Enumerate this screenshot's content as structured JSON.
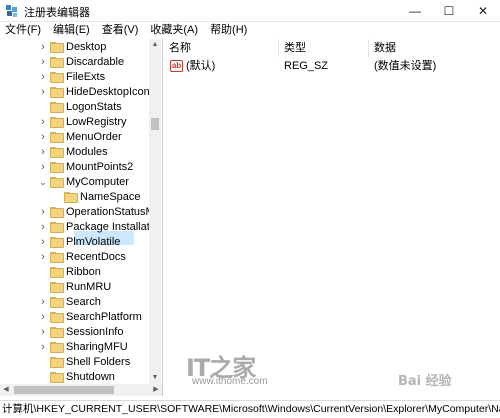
{
  "window": {
    "title": "注册表编辑器",
    "minimize": "—",
    "maximize": "☐",
    "close": "✕"
  },
  "menu": [
    "文件(F)",
    "编辑(E)",
    "查看(V)",
    "收藏夹(A)",
    "帮助(H)"
  ],
  "tree": {
    "items": [
      {
        "label": "Desktop",
        "expanded": false
      },
      {
        "label": "Discardable",
        "expanded": false
      },
      {
        "label": "FileExts",
        "expanded": false
      },
      {
        "label": "HideDesktopIcons",
        "expanded": false
      },
      {
        "label": "LogonStats",
        "expanded": null
      },
      {
        "label": "LowRegistry",
        "expanded": false
      },
      {
        "label": "MenuOrder",
        "expanded": false
      },
      {
        "label": "Modules",
        "expanded": false
      },
      {
        "label": "MountPoints2",
        "expanded": false
      },
      {
        "label": "MyComputer",
        "expanded": true
      },
      {
        "label": "NameSpace",
        "expanded": null,
        "selected": true
      },
      {
        "label": "OperationStatusMa",
        "expanded": false
      },
      {
        "label": "Package Installatio",
        "expanded": false
      },
      {
        "label": "PlmVolatile",
        "expanded": false
      },
      {
        "label": "RecentDocs",
        "expanded": false
      },
      {
        "label": "Ribbon",
        "expanded": null
      },
      {
        "label": "RunMRU",
        "expanded": null
      },
      {
        "label": "Search",
        "expanded": false
      },
      {
        "label": "SearchPlatform",
        "expanded": false
      },
      {
        "label": "SessionInfo",
        "expanded": false
      },
      {
        "label": "SharingMFU",
        "expanded": false
      },
      {
        "label": "Shell Folders",
        "expanded": null
      },
      {
        "label": "Shutdown",
        "expanded": null
      }
    ]
  },
  "list": {
    "columns": {
      "name": "名称",
      "type": "类型",
      "data": "数据"
    },
    "rows": [
      {
        "icon": "ab",
        "name": "(默认)",
        "type": "REG_SZ",
        "data": "(数值未设置)"
      }
    ]
  },
  "watermark": {
    "logo": "IT之家",
    "url": "www.ithome.com",
    "baidu": "Bai 经验"
  },
  "status": {
    "path": "计算机\\HKEY_CURRENT_USER\\SOFTWARE\\Microsoft\\Windows\\CurrentVersion\\Explorer\\MyComputer\\NameSpace"
  }
}
